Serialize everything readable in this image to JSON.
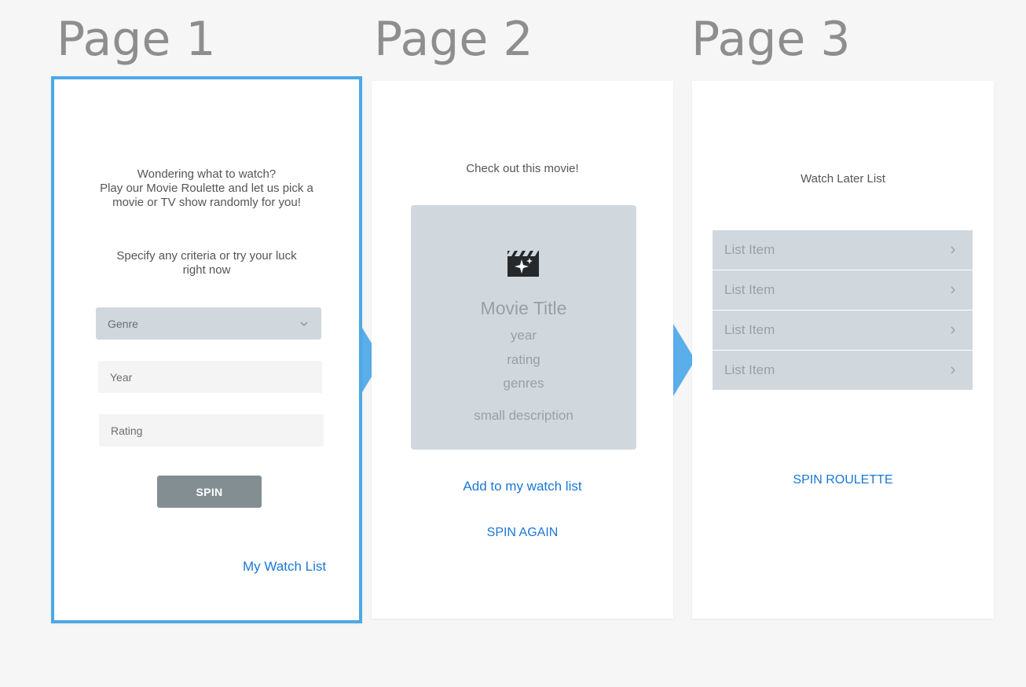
{
  "headings": {
    "page1": "Page 1",
    "page2": "Page 2",
    "page3": "Page 3"
  },
  "page1": {
    "intro_line1": "Wondering what to watch?",
    "intro_line2": "Play our Movie Roulette and let us pick a",
    "intro_line3": "movie or TV show randomly for you!",
    "criteria_line1": "Specify any criteria or try your luck",
    "criteria_line2": "right now",
    "genre_label": "Genre",
    "year_placeholder": "Year",
    "rating_placeholder": "Rating",
    "spin_label": "SPIN",
    "watchlist_link": "My Watch List"
  },
  "page2": {
    "heading": "Check out this movie!",
    "movie_title": "Movie Title",
    "year": "year",
    "rating": "rating",
    "genres": "genres",
    "description": "small description",
    "add_link": "Add to my watch list",
    "spin_again": "SPIN AGAIN"
  },
  "page3": {
    "heading": "Watch Later List",
    "items": [
      {
        "label": "List Item"
      },
      {
        "label": "List Item"
      },
      {
        "label": "List Item"
      },
      {
        "label": "List Item"
      }
    ],
    "spin_roulette": "SPIN ROULETTE"
  },
  "icons": {
    "movie": "movie-clapper-icon",
    "chevron_down": "chevron-down-icon",
    "chevron_right": "chevron-right-icon"
  },
  "colors": {
    "selected_border": "#4ea8e6",
    "link": "#1a77d6",
    "card_bg": "#d0d8de",
    "button_bg": "#838e93",
    "arrow": "#5aaeea"
  }
}
